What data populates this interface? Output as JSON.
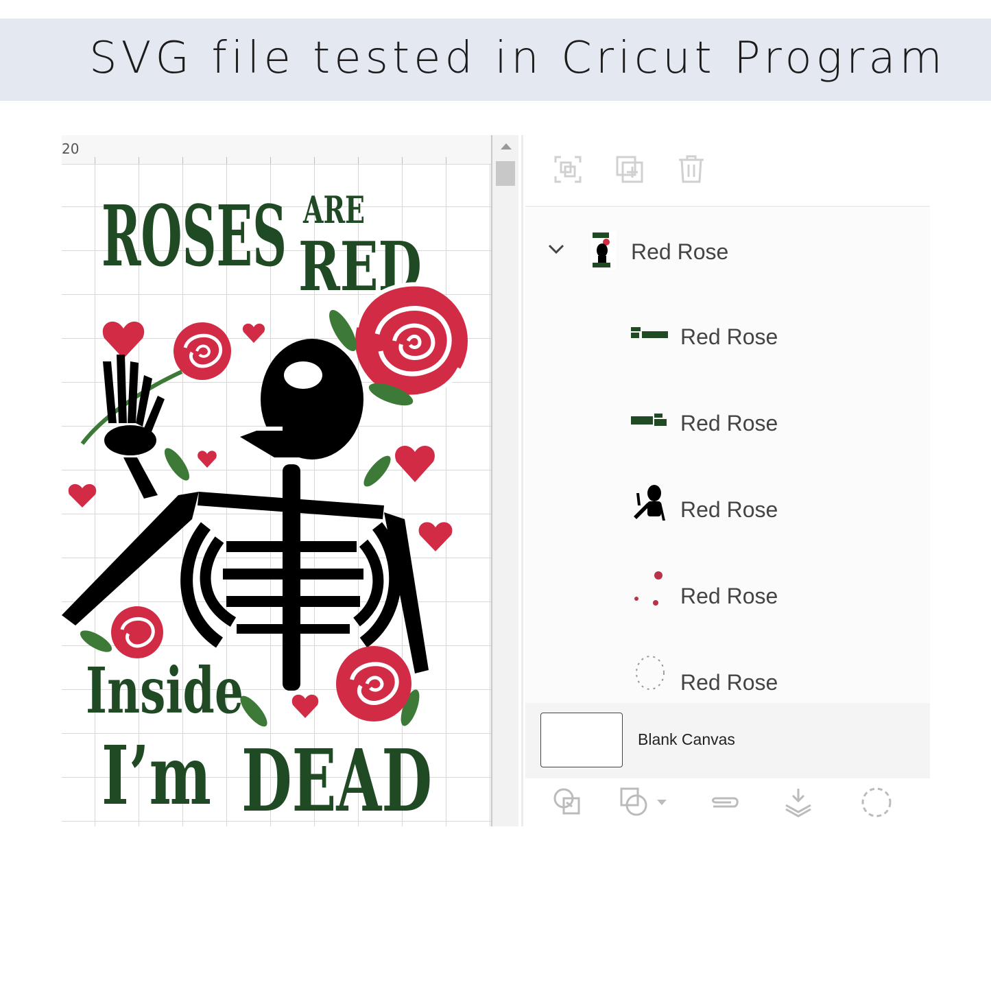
{
  "banner": {
    "title": "SVG file tested in Cricut Program"
  },
  "canvas": {
    "ruler_label": "20",
    "design_text": {
      "roses": "ROSES",
      "are": "ARE",
      "red": "RED",
      "inside": "Inside",
      "im_dead_1": "I’m",
      "im_dead_2": "DEAD"
    }
  },
  "layers_panel": {
    "top_toolbar": [
      "group-icon",
      "duplicate-icon",
      "delete-icon"
    ],
    "group": {
      "name": "Red Rose",
      "expanded": true
    },
    "layers": [
      {
        "name": "Red Rose",
        "thumb": "text-inside-im-dead"
      },
      {
        "name": "Red Rose",
        "thumb": "text-roses-are-red"
      },
      {
        "name": "Red Rose",
        "thumb": "skeleton"
      },
      {
        "name": "Red Rose",
        "thumb": "hearts"
      },
      {
        "name": "Red Rose",
        "thumb": "dotted-outline"
      }
    ],
    "blank_canvas": {
      "label": "Blank Canvas"
    },
    "bottom_toolbar": [
      "slice-icon",
      "combine-icon",
      "attach-icon",
      "flatten-icon",
      "contour-icon"
    ]
  },
  "colors": {
    "banner_bg": "#e3e8f1",
    "text_green": "#1f4a24",
    "rose_red": "#d22b45",
    "leaf_green": "#3d7a38"
  }
}
